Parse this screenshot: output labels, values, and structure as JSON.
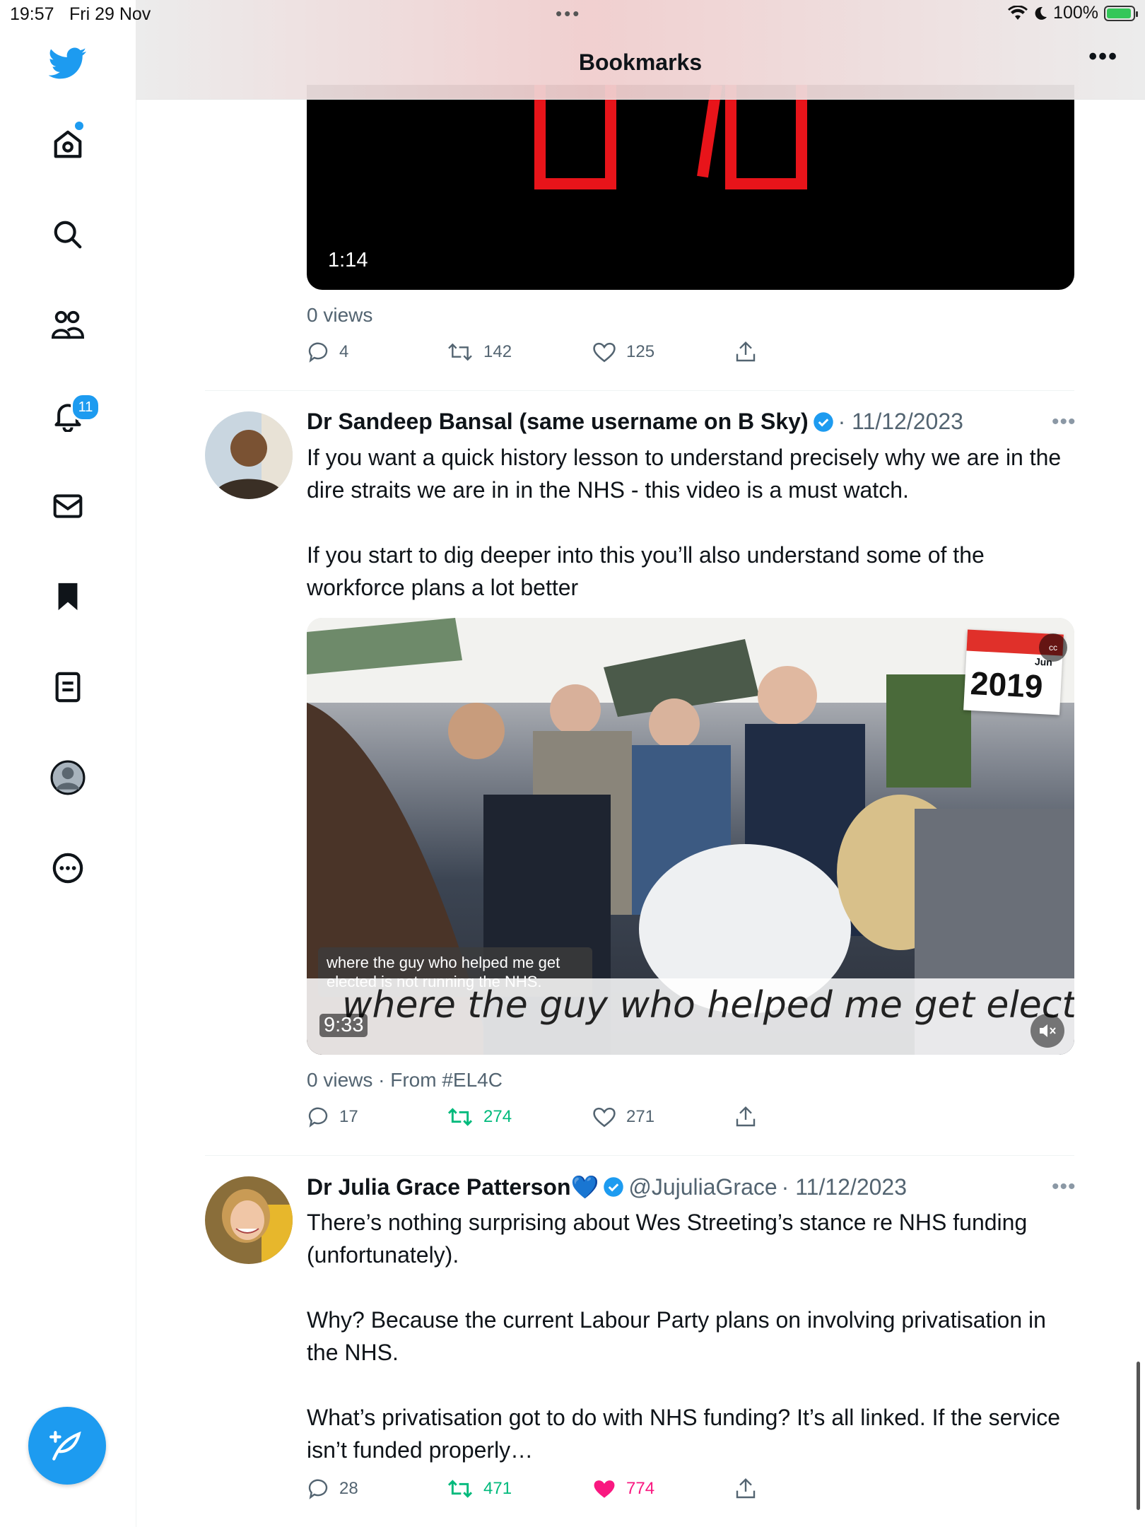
{
  "status_bar": {
    "time": "19:57",
    "date": "Fri 29 Nov",
    "battery": "100%"
  },
  "header": {
    "title": "Bookmarks"
  },
  "sidebar": {
    "notification_badge": "11"
  },
  "colors": {
    "accent": "#1d9bf0",
    "retweet_active": "#00ba7c",
    "like_active": "#f91880",
    "muted_text": "#536471"
  },
  "tweets": [
    {
      "media_duration": "1:14",
      "views": "0 views",
      "replies": "4",
      "retweets": "142",
      "likes": "125"
    },
    {
      "name": "Dr Sandeep Bansal (same username on B Sky)",
      "handle": "",
      "date": "· 11/12/2023",
      "paragraphs": [
        "If you want a quick history lesson to understand precisely why we are in the dire straits we are in in the NHS - this video is a must watch.",
        "If you start to dig deeper into this you’ll also understand some of the workforce plans a lot better"
      ],
      "media_caption": "where the guy who helped me get elected is not running the NHS.",
      "media_subtitle": "where the guy who helped me get elected",
      "media_duration": "9:33",
      "calendar_month": "Jun",
      "calendar_year": "2019",
      "views": "0 views · From #EL4C",
      "replies": "17",
      "retweets": "274",
      "likes": "271"
    },
    {
      "name": "Dr Julia Grace Patterson💙",
      "handle": "@JujuliaGrace",
      "date": "· 11/12/2023",
      "paragraphs": [
        "There’s nothing surprising about Wes Streeting’s stance re NHS funding (unfortunately).",
        "Why? Because the current Labour Party plans on involving privatisation in the NHS.",
        "What’s privatisation got to do with NHS funding? It’s all linked. If the service isn’t funded properly…"
      ],
      "replies": "28",
      "retweets": "471",
      "likes": "774"
    }
  ]
}
